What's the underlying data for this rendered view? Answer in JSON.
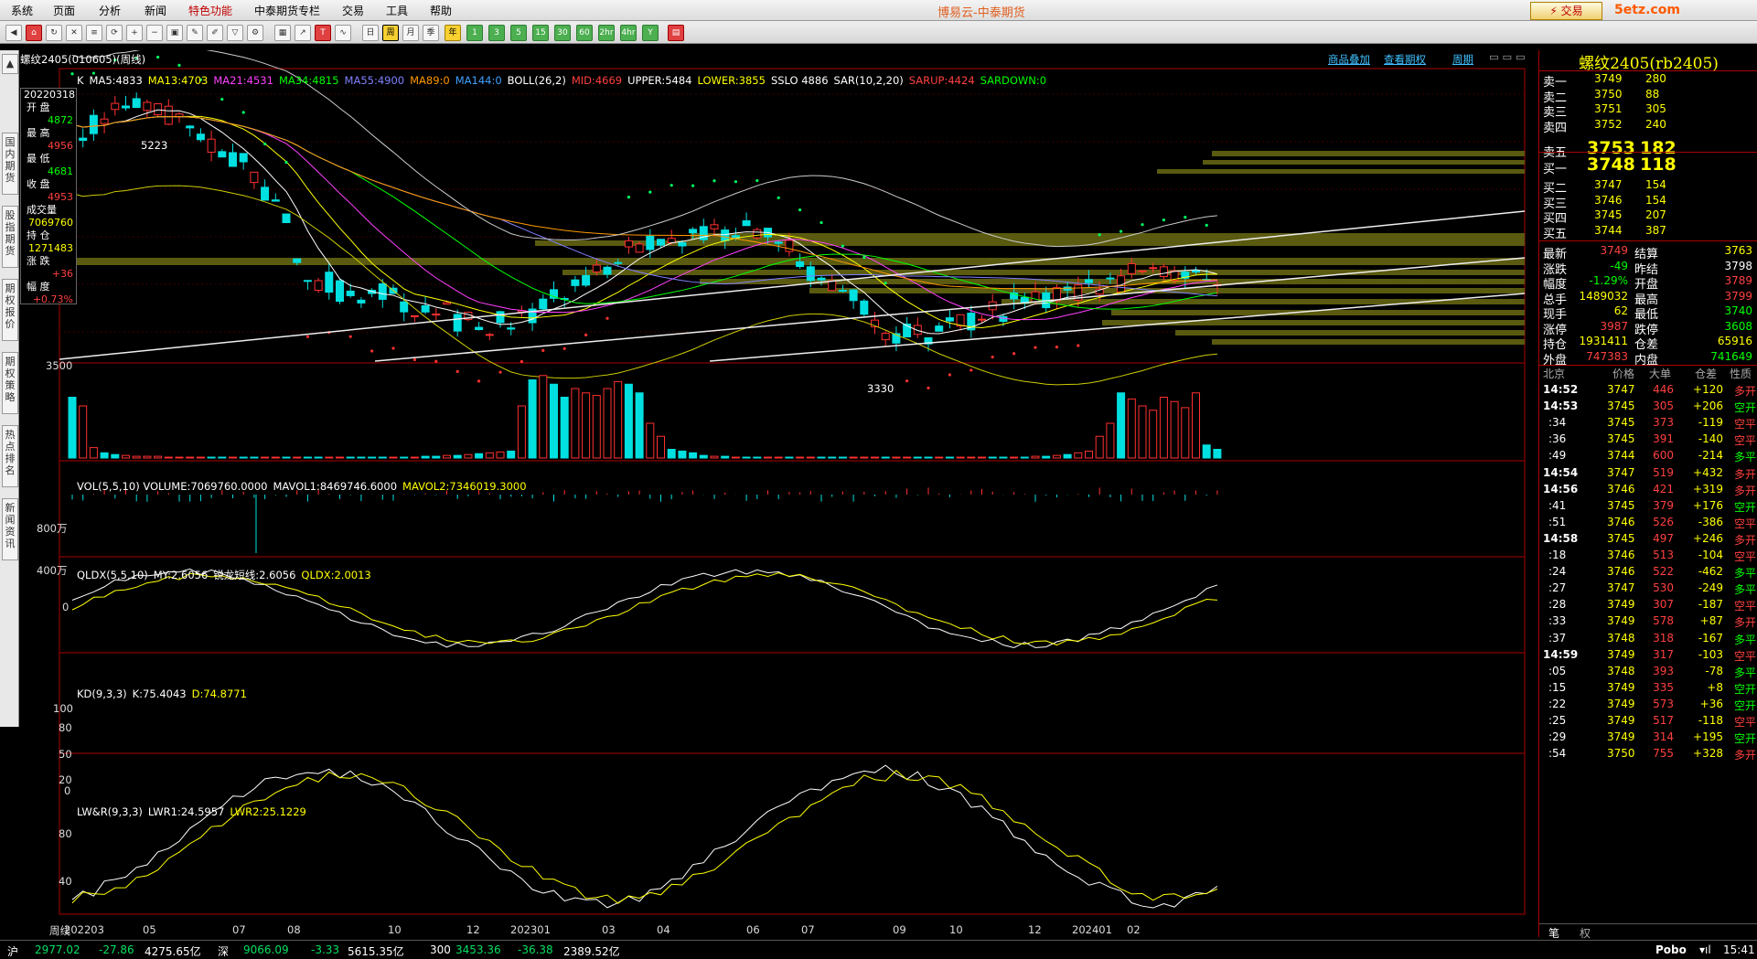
{
  "menu": {
    "items": [
      "系统",
      "页面",
      "分析",
      "新闻",
      "特色功能",
      "中泰期货专栏",
      "交易",
      "工具",
      "帮助"
    ],
    "highlight": 4
  },
  "app_title": "博易云-中泰期货",
  "trade_button": "交易",
  "site_logo": "5etz.com",
  "toolbar": {
    "labels": [
      "1",
      "3",
      "5",
      "15",
      "30",
      "60",
      "2hr",
      "4hr",
      "Y"
    ],
    "period_week": "周",
    "period_day": "日",
    "period_month": "月",
    "period_season": "季"
  },
  "left_tabs": [
    "国内期货",
    "股指期货",
    "期权报价",
    "期权策略",
    "热点排名",
    "新闻资讯"
  ],
  "chart": {
    "symbol_title": "螺纹2405(010605)(周线)",
    "links": [
      "商品叠加",
      "查看期权",
      "周期"
    ],
    "ma_legend": [
      {
        "text": "K",
        "color": "#ffffff"
      },
      {
        "text": "MA5:4833",
        "color": "#ffffff"
      },
      {
        "text": "MA13:4703",
        "color": "#ffff00"
      },
      {
        "text": "MA21:4531",
        "color": "#ff40ff"
      },
      {
        "text": "MA34:4815",
        "color": "#00ff00"
      },
      {
        "text": "MA55:4900",
        "color": "#8080ff"
      },
      {
        "text": "MA89:0",
        "color": "#ff9900"
      },
      {
        "text": "MA144:0",
        "color": "#40a0ff"
      },
      {
        "text": "BOLL(26,2)",
        "color": "#ffffff"
      },
      {
        "text": "MID:4669",
        "color": "#ff4040"
      },
      {
        "text": "UPPER:5484",
        "color": "#ffffff"
      },
      {
        "text": "LOWER:3855",
        "color": "#ffff00"
      },
      {
        "text": "SSLO 4886",
        "color": "#ffffff"
      },
      {
        "text": "SAR(10,2,20)",
        "color": "#ffffff"
      },
      {
        "text": "SARUP:4424",
        "color": "#ff4040"
      },
      {
        "text": "SARDOWN:0",
        "color": "#00ff00"
      }
    ],
    "price_high_label": "5223",
    "price_low_label": "3330",
    "price_axis_label": "3500",
    "vol_legend": [
      {
        "text": "VOL(5,5,10) VOLUME:7069760.0000",
        "color": "#ffffff"
      },
      {
        "text": "MAVOL1:8469746.6000",
        "color": "#ffffff"
      },
      {
        "text": "MAVOL2:7346019.3000",
        "color": "#ffff00"
      }
    ],
    "vol_axis": [
      "800万",
      "400万"
    ],
    "qldx_legend": [
      {
        "text": "QLDX(5,5,10)",
        "color": "#ffffff"
      },
      {
        "text": "MY:2.6056",
        "color": "#ffffff"
      },
      {
        "text": "锐龙短线:2.6056",
        "color": "#ffffff"
      },
      {
        "text": "QLDX:2.0013",
        "color": "#ffff00"
      }
    ],
    "qldx_axis": [
      "0"
    ],
    "kd_legend": [
      {
        "text": "KD(9,3,3)",
        "color": "#ffffff"
      },
      {
        "text": "K:75.4043",
        "color": "#ffffff"
      },
      {
        "text": "D:74.8771",
        "color": "#ffff00"
      }
    ],
    "kd_axis": [
      "100",
      "80",
      "50",
      "20",
      "0"
    ],
    "lwr_legend": [
      {
        "text": "LW&R(9,3,3)",
        "color": "#ffffff"
      },
      {
        "text": "LWR1:24.5957",
        "color": "#ffffff"
      },
      {
        "text": "LWR2:25.1229",
        "color": "#ffff00"
      }
    ],
    "lwr_axis": [
      "80",
      "40"
    ],
    "x_axis_prefix": "周线",
    "x_axis": [
      "202203",
      "05",
      "07",
      "08",
      "10",
      "12",
      "202301",
      "03",
      "04",
      "06",
      "07",
      "09",
      "10",
      "12",
      "202401",
      "02"
    ]
  },
  "infobox": {
    "date": "20220318",
    "rows": [
      {
        "label": "开  盘",
        "value": "4872",
        "color": "#00ff00"
      },
      {
        "label": "最  高",
        "value": "4956",
        "color": "#ff4040"
      },
      {
        "label": "最  低",
        "value": "4681",
        "color": "#00ff00"
      },
      {
        "label": "收  盘",
        "value": "4953",
        "color": "#ff4040"
      },
      {
        "label": "成交量",
        "value": "7069760",
        "color": "#ffff00"
      },
      {
        "label": "持  仓",
        "value": "1271483",
        "color": "#ffff00"
      },
      {
        "label": "涨  跌",
        "value": "+36",
        "color": "#ff4040"
      },
      {
        "label": "幅  度",
        "value": "+0.73%",
        "color": "#ff4040"
      }
    ]
  },
  "quote": {
    "title": "螺纹2405(rb2405)",
    "asks": [
      {
        "label": "卖五",
        "price": "3753",
        "vol": "182"
      },
      {
        "label": "卖四",
        "price": "3752",
        "vol": "240"
      },
      {
        "label": "卖三",
        "price": "3751",
        "vol": "305"
      },
      {
        "label": "卖二",
        "price": "3750",
        "vol": "88"
      },
      {
        "label": "卖一",
        "price": "3749",
        "vol": "280"
      }
    ],
    "bids": [
      {
        "label": "买一",
        "price": "3748",
        "vol": "118"
      },
      {
        "label": "买二",
        "price": "3747",
        "vol": "154"
      },
      {
        "label": "买三",
        "price": "3746",
        "vol": "154"
      },
      {
        "label": "买四",
        "price": "3745",
        "vol": "207"
      },
      {
        "label": "买五",
        "price": "3744",
        "vol": "387"
      }
    ],
    "stats": [
      {
        "l1": "最新",
        "v1": "3749",
        "c1": "#ff4040",
        "l2": "结算",
        "v2": "3763",
        "c2": "#ffff00"
      },
      {
        "l1": "涨跌",
        "v1": "-49",
        "c1": "#00ff00",
        "l2": "昨结",
        "v2": "3798",
        "c2": "#ffffff"
      },
      {
        "l1": "幅度",
        "v1": "-1.29%",
        "c1": "#00ff00",
        "l2": "开盘",
        "v2": "3789",
        "c2": "#ff4040"
      },
      {
        "l1": "总手",
        "v1": "1489032",
        "c1": "#ffff00",
        "l2": "最高",
        "v2": "3799",
        "c2": "#ff4040"
      },
      {
        "l1": "现手",
        "v1": "62",
        "c1": "#ffff00",
        "l2": "最低",
        "v2": "3740",
        "c2": "#00ff00"
      },
      {
        "l1": "涨停",
        "v1": "3987",
        "c1": "#ff4040",
        "l2": "跌停",
        "v2": "3608",
        "c2": "#00ff00"
      },
      {
        "l1": "持仓",
        "v1": "1931411",
        "c1": "#ffff00",
        "l2": "仓差",
        "v2": "65916",
        "c2": "#ffff00"
      },
      {
        "l1": "外盘",
        "v1": "747383",
        "c1": "#ff4040",
        "l2": "内盘",
        "v2": "741649",
        "c2": "#00ff00"
      }
    ],
    "ticks_header": [
      "北京",
      "价格",
      "大单",
      "仓差",
      "性质"
    ],
    "ticks": [
      {
        "t": "14:52",
        "p": "3747",
        "v": "446",
        "d": "+120",
        "k": "多开",
        "bold": true
      },
      {
        "t": "14:53",
        "p": "3745",
        "v": "305",
        "d": "+206",
        "k": "空开",
        "bold": true
      },
      {
        "t": ":34",
        "p": "3745",
        "v": "373",
        "d": "-119",
        "k": "空平"
      },
      {
        "t": ":36",
        "p": "3745",
        "v": "391",
        "d": "-140",
        "k": "空平"
      },
      {
        "t": ":49",
        "p": "3744",
        "v": "600",
        "d": "-214",
        "k": "多平"
      },
      {
        "t": "14:54",
        "p": "3747",
        "v": "519",
        "d": "+432",
        "k": "多开",
        "bold": true
      },
      {
        "t": "14:56",
        "p": "3746",
        "v": "421",
        "d": "+319",
        "k": "多开",
        "bold": true
      },
      {
        "t": ":41",
        "p": "3745",
        "v": "379",
        "d": "+176",
        "k": "空开"
      },
      {
        "t": ":51",
        "p": "3746",
        "v": "526",
        "d": "-386",
        "k": "空平"
      },
      {
        "t": "14:58",
        "p": "3745",
        "v": "497",
        "d": "+246",
        "k": "多开",
        "bold": true
      },
      {
        "t": ":18",
        "p": "3746",
        "v": "513",
        "d": "-104",
        "k": "空平"
      },
      {
        "t": ":24",
        "p": "3746",
        "v": "522",
        "d": "-462",
        "k": "多平"
      },
      {
        "t": ":27",
        "p": "3747",
        "v": "530",
        "d": "-249",
        "k": "多平"
      },
      {
        "t": ":28",
        "p": "3749",
        "v": "307",
        "d": "-187",
        "k": "空平"
      },
      {
        "t": ":33",
        "p": "3749",
        "v": "578",
        "d": "+87",
        "k": "多开"
      },
      {
        "t": ":37",
        "p": "3748",
        "v": "318",
        "d": "-167",
        "k": "多平"
      },
      {
        "t": "14:59",
        "p": "3749",
        "v": "317",
        "d": "-103",
        "k": "空平",
        "bold": true
      },
      {
        "t": ":05",
        "p": "3748",
        "v": "393",
        "d": "-78",
        "k": "多平"
      },
      {
        "t": ":15",
        "p": "3749",
        "v": "335",
        "d": "+8",
        "k": "空开"
      },
      {
        "t": ":22",
        "p": "3749",
        "v": "573",
        "d": "+36",
        "k": "空开"
      },
      {
        "t": ":25",
        "p": "3749",
        "v": "517",
        "d": "-118",
        "k": "空平"
      },
      {
        "t": ":29",
        "p": "3749",
        "v": "314",
        "d": "+195",
        "k": "空开"
      },
      {
        "t": ":54",
        "p": "3750",
        "v": "755",
        "d": "+328",
        "k": "多开"
      }
    ],
    "bottom_tabs": [
      "笔",
      "权"
    ]
  },
  "status": {
    "sh_label": "沪",
    "sh_index": "2977.02",
    "sh_change": "-27.86",
    "sh_amount": "4275.65亿",
    "sz_label": "深",
    "sz_index": "9066.09",
    "sz_change": "-3.33",
    "sz_amount": "5615.35亿",
    "c300_label": "300",
    "c300_index": "3453.36",
    "c300_change": "-36.38",
    "c300_amount": "2389.52亿",
    "brand": "Pobo",
    "time": "15:41"
  }
}
